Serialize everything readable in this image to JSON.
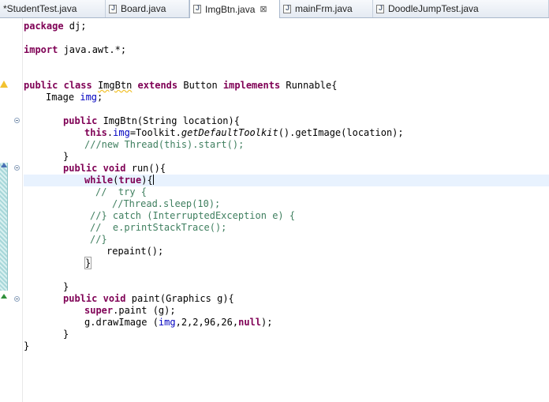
{
  "tabs": [
    {
      "label": "*StudentTest.java",
      "active": false
    },
    {
      "label": "Board.java",
      "active": false
    },
    {
      "label": "ImgBtn.java",
      "active": true
    },
    {
      "label": "mainFrm.java",
      "active": false
    },
    {
      "label": "DoodleJumpTest.java",
      "active": false
    }
  ],
  "tab_close_glyph": "⊠",
  "code": {
    "l1": {
      "kw": "package",
      "rest": " dj;"
    },
    "l2": {
      "kw": "import",
      "rest": " java.awt.*;"
    },
    "l3": {
      "kw1": "public",
      "kw2": "class",
      "name": "ImgBtn",
      "kw3": "extends",
      "sup": " Button ",
      "kw4": "implements",
      "intf": " Runnable{"
    },
    "l4": {
      "type": "Image ",
      "fld": "img",
      "end": ";"
    },
    "l5": {
      "kw": "public",
      "rest": " ImgBtn(String location){"
    },
    "l6": {
      "kw": "this",
      "dot": ".",
      "fld": "img",
      "mid": "=Toolkit.",
      "it": "getDefaultToolkit",
      "rest": "().getImage(location);"
    },
    "l7": {
      "cm": "///new Thread(this).start();"
    },
    "l8": {
      "text": "}"
    },
    "l9": {
      "kw1": "public",
      "kw2": "void",
      "rest": " run(){"
    },
    "l10": {
      "kw1": "while",
      "open": "(",
      "kw2": "true",
      "close": "){"
    },
    "l11": {
      "cm": "//  try {"
    },
    "l12": {
      "cm": "//Thread.sleep(10);"
    },
    "l13": {
      "cm": "//} catch (InterruptedException e) {"
    },
    "l14": {
      "cm": "//  e.printStackTrace();"
    },
    "l15": {
      "cm": "//}"
    },
    "l16": {
      "text": "repaint();"
    },
    "l17": {
      "text": "}"
    },
    "l18": {
      "text": "}"
    },
    "l19": {
      "kw1": "public",
      "kw2": "void",
      "rest": " paint(Graphics g){"
    },
    "l20": {
      "kw": "super",
      "rest": ".paint (g);"
    },
    "l21": {
      "pre": "g.drawImage (",
      "fld": "img",
      "mid": ",2,2,96,26,",
      "kw": "null",
      "end": ");"
    },
    "l22": {
      "text": "}"
    },
    "l23": {
      "text": "}"
    }
  },
  "icons": {
    "tab_file": "java-file-icon",
    "warning": "warning-icon",
    "fold": "fold-collapse-icon",
    "override": "override-marker-icon"
  }
}
